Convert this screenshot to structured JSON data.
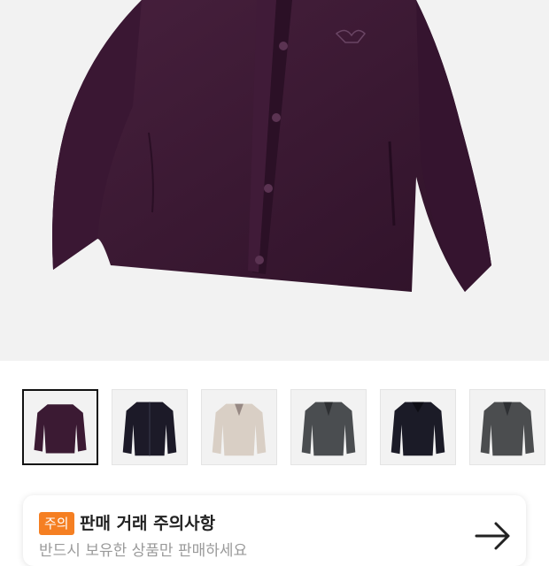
{
  "product": {
    "hero_alt": "purple cardigan",
    "thumbnails": [
      {
        "color": "#3b1a33",
        "selected": true
      },
      {
        "color": "#1c1a28",
        "selected": false
      },
      {
        "color": "#d9cfc5",
        "selected": false
      },
      {
        "color": "#4a4d50",
        "selected": false
      },
      {
        "color": "#1b1b27",
        "selected": false
      },
      {
        "color": "#4b4d4f",
        "selected": false
      }
    ]
  },
  "notice": {
    "badge": "주의",
    "title": "판매 거래 주의사항",
    "subtitle": "반드시 보유한 상품만 판매하세요",
    "icon": "arrow-right-icon"
  },
  "colors": {
    "accent": "#f57f22",
    "hero_bg": "#f2f2f2",
    "garment": "#3b1a33"
  }
}
